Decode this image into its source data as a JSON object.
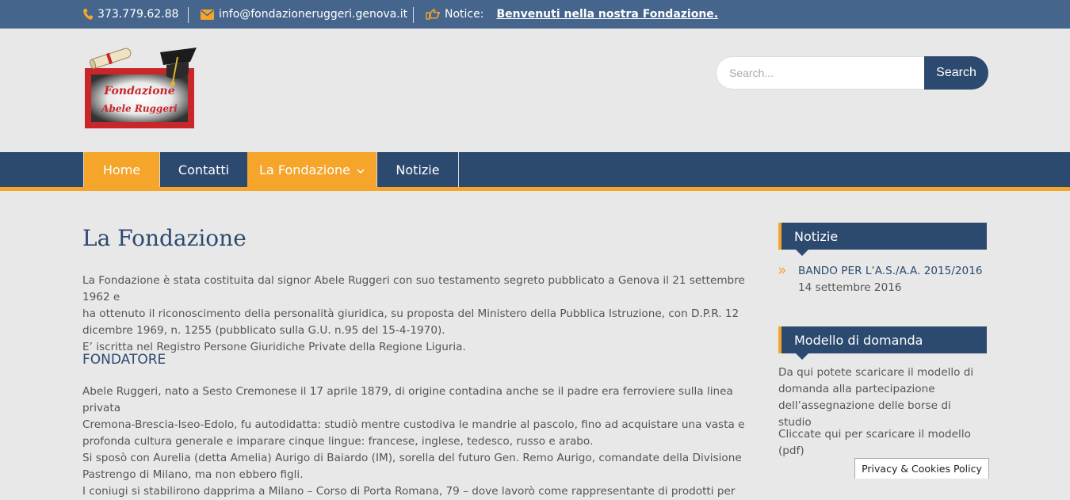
{
  "topbar": {
    "phone": "373.779.62.88",
    "email": "info@fondazioneruggeri.genova.it",
    "notice_label": "Notice:",
    "notice_text": "Benvenuti nella nostra Fondazione."
  },
  "logo": {
    "line1": "Fondazione",
    "line2": "Abele Ruggeri"
  },
  "search": {
    "placeholder": "Search...",
    "button_label": "Search"
  },
  "nav": {
    "items": [
      {
        "label": "Home"
      },
      {
        "label": "Contatti"
      },
      {
        "label": "La Fondazione"
      },
      {
        "label": "Notizie"
      }
    ]
  },
  "main": {
    "title": "La Fondazione",
    "para1": [
      "La Fondazione è stata costituita dal signor Abele Ruggeri con suo testamento segreto pubblicato a Genova il 21 settembre 1962 e",
      "ha ottenuto il riconoscimento della personalità giuridica, su proposta del Ministero della Pubblica Istruzione, con D.P.R. 12",
      "dicembre 1969, n. 1255 (pubblicato sulla G.U. n.95 del 15-4-1970).",
      "E’ iscritta nel Registro Persone Giuridiche Private della Regione Liguria."
    ],
    "section_title": "FONDATORE",
    "para2": [
      "Abele Ruggeri, nato a Sesto Cremonese il 17 aprile 1879, di origine contadina anche se il padre era ferroviere sulla linea privata",
      "Cremona-Brescia-Iseo-Edolo, fu autodidatta: studiò mentre custodiva le mandrie al pascolo, fino ad acquistare una vasta e",
      "profonda cultura generale e imparare cinque lingue: francese, inglese, tedesco, russo e arabo.",
      "Si sposò con Aurelia (detta Amelia) Aurigo di Baiardo (IM), sorella del futuro Gen. Remo Aurigo, comandate della Divisione",
      "Pastrengo di Milano, ma non ebbero figli.",
      "I coniugi si stabilirono dapprima a Milano – Corso di Porta Romana, 79 – dove lavorò come rappresentante di prodotti per"
    ]
  },
  "sidebar": {
    "notizie_title": "Notizie",
    "notizie_item_title": "BANDO PER L’A.S./A.A. 2015/2016",
    "notizie_item_date": "14 settembre 2016",
    "modello_title": "Modello di domanda",
    "modello_text": [
      "Da qui potete scaricare il modello di",
      "domanda alla partecipazione",
      "dell’assegnazione delle borse di studio"
    ],
    "modello_link": [
      "Cliccate qui per scaricare il modello",
      "(pdf)"
    ]
  },
  "cookie": {
    "label": "Privacy & Cookies Policy"
  },
  "colors": {
    "topbar": "#45658c",
    "navy": "#2c4a6f",
    "accent": "#f5a52a",
    "background": "#e8e8e8"
  }
}
